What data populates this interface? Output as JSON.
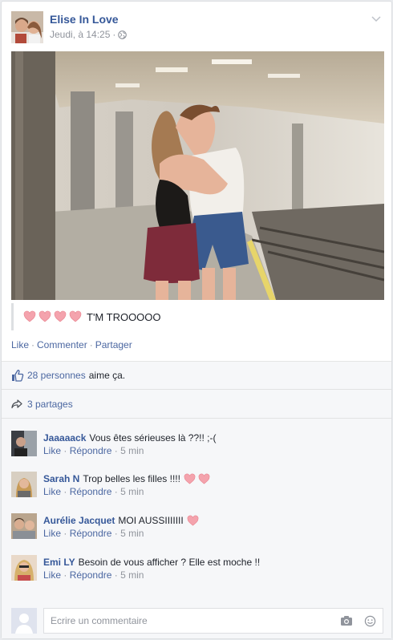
{
  "post": {
    "author": "Elise In Love",
    "timestamp": "Jeudi, à 14:25",
    "separator": "·",
    "quote_text": "T'M TROOOOO"
  },
  "actions": {
    "like": "Like",
    "comment": "Commenter",
    "share": "Partager",
    "separator": "·"
  },
  "stats": {
    "likes_count": "28 personnes",
    "likes_suffix": "aime ça.",
    "shares": "3 partages"
  },
  "comments": [
    {
      "name": "Jaaaaack",
      "text": "Vous êtes sérieuses là ??!! ;-(",
      "like": "Like",
      "reply": "Répondre",
      "time": "5 min",
      "sep": "·"
    },
    {
      "name": "Sarah N",
      "text": "Trop belles les filles !!!!",
      "like": "Like",
      "reply": "Répondre",
      "time": "5 min",
      "sep": "·"
    },
    {
      "name": "Aurélie Jacquet",
      "text": "MOI AUSSIIIIIII",
      "like": "Like",
      "reply": "Répondre",
      "time": "5 min",
      "sep": "·"
    },
    {
      "name": "Emi LY",
      "text": "Besoin de vous afficher ? Elle est moche !!",
      "like": "Like",
      "reply": "Répondre",
      "time": "5 min",
      "sep": "·"
    }
  ],
  "composer": {
    "placeholder": "Ecrire un commentaire"
  },
  "colors": {
    "link": "#365899",
    "heart": "#f4a3ad",
    "muted": "#90949c"
  }
}
